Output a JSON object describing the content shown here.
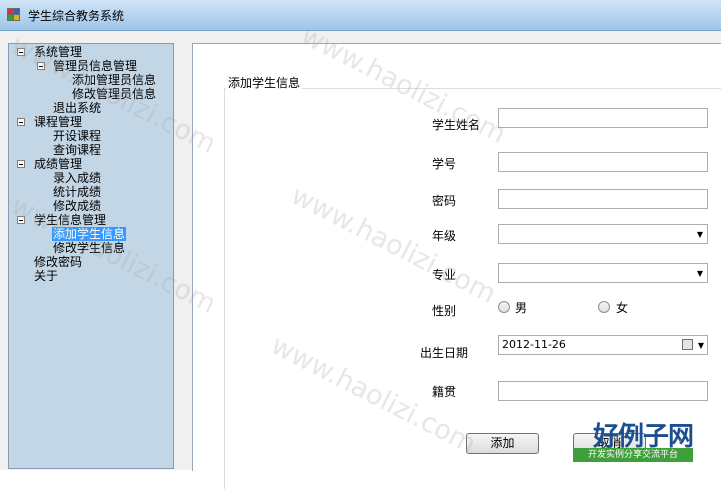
{
  "window": {
    "title": "学生综合教务系统"
  },
  "tree": {
    "nodes": [
      {
        "label": "系统管理",
        "level": 0,
        "expanded": true
      },
      {
        "label": "管理员信息管理",
        "level": 1,
        "expanded": true
      },
      {
        "label": "添加管理员信息",
        "level": 2
      },
      {
        "label": "修改管理员信息",
        "level": 2
      },
      {
        "label": "退出系统",
        "level": 1
      },
      {
        "label": "课程管理",
        "level": 0,
        "expanded": true
      },
      {
        "label": "开设课程",
        "level": 1
      },
      {
        "label": "查询课程",
        "level": 1
      },
      {
        "label": "成绩管理",
        "level": 0,
        "expanded": true
      },
      {
        "label": "录入成绩",
        "level": 1
      },
      {
        "label": "统计成绩",
        "level": 1
      },
      {
        "label": "修改成绩",
        "level": 1
      },
      {
        "label": "学生信息管理",
        "level": 0,
        "expanded": true
      },
      {
        "label": "添加学生信息",
        "level": 1,
        "selected": true
      },
      {
        "label": "修改学生信息",
        "level": 1
      },
      {
        "label": "修改密码",
        "level": 0
      },
      {
        "label": "关于",
        "level": 0
      }
    ]
  },
  "form": {
    "group_title": "添加学生信息",
    "name_label": "学生姓名",
    "name_value": "",
    "id_label": "学号",
    "id_value": "",
    "password_label": "密码",
    "password_value": "",
    "grade_label": "年级",
    "grade_value": "",
    "major_label": "专业",
    "major_value": "",
    "gender_label": "性别",
    "gender_male": "男",
    "gender_female": "女",
    "birth_label": "出生日期",
    "birth_value": "2012-11-26",
    "native_label": "籍贯",
    "native_value": "",
    "add_button": "添加",
    "cancel_button": "取消"
  },
  "watermark": {
    "text": "www.haolizi.com",
    "logo_main": "好例子网",
    "logo_sub": "开发实例分享交流平台"
  },
  "colors": {
    "tree_bg": "#c3d6e6",
    "selection": "#3399ff",
    "titlebar": "#b8d6f0"
  }
}
